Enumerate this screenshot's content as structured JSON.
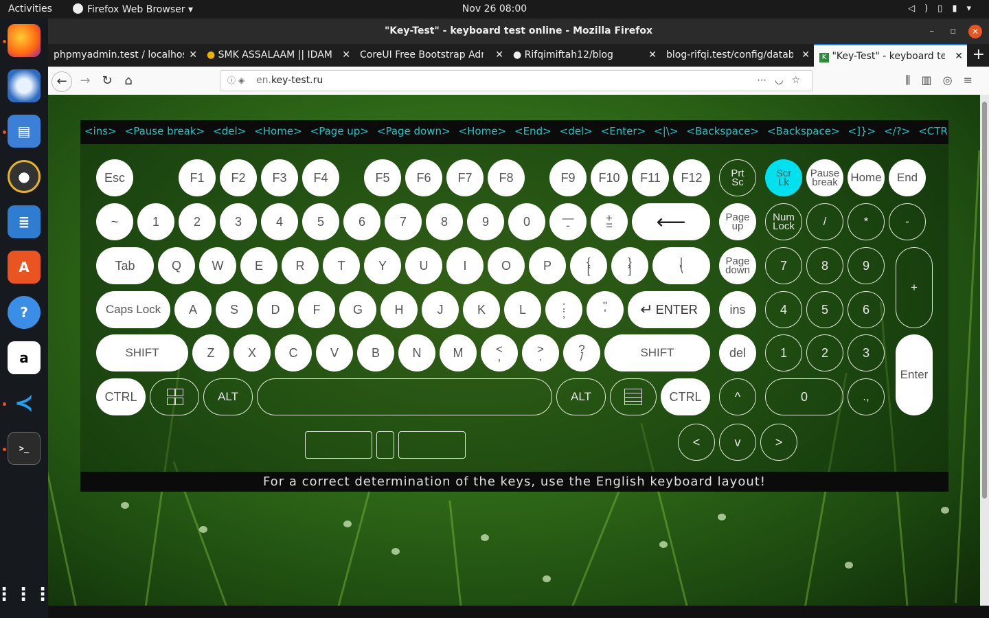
{
  "topbar": {
    "activities": "Activities",
    "app_name": "Firefox Web Browser",
    "clock": "Nov 26  08:00"
  },
  "window": {
    "title": "\"Key-Test\" - keyboard test online - Mozilla Firefox"
  },
  "tabs": [
    {
      "title": "phpmyadmin.test / localhost",
      "active": false
    },
    {
      "title": "SMK ASSALAAM || IDAM",
      "active": false
    },
    {
      "title": "CoreUI Free Bootstrap Admin",
      "active": false
    },
    {
      "title": "Rifqimiftah12/blog",
      "active": false
    },
    {
      "title": "blog-rifqi.test/config/database",
      "active": false
    },
    {
      "title": "\"Key-Test\" - keyboard test",
      "active": true
    }
  ],
  "nav": {
    "url_prefix": "en.",
    "url_domain": "key-test.ru"
  },
  "page": {
    "history": [
      "<ins>",
      "<Pause break>",
      "<del>",
      "<Home>",
      "<Page up>",
      "<Page down>",
      "<Home>",
      "<End>",
      "<del>",
      "<Enter>",
      "<|\\>",
      "<Backspace>",
      "<Backspace>",
      "<]}>",
      "</?>",
      "<CTRL>",
      "<'\">",
      "<[{>"
    ],
    "notice": "For a correct determination of the keys, use the English keyboard layout!"
  },
  "keys": {
    "esc": "Esc",
    "f1": "F1",
    "f2": "F2",
    "f3": "F3",
    "f4": "F4",
    "f5": "F5",
    "f6": "F6",
    "f7": "F7",
    "f8": "F8",
    "f9": "F9",
    "f10": "F10",
    "f11": "F11",
    "f12": "F12",
    "prtsc_1": "Prt",
    "prtsc_2": "Sc",
    "scrlk_1": "Scr",
    "scrlk_2": "Lk",
    "pause_1": "Pause",
    "pause_2": "break",
    "home": "Home",
    "end": "End",
    "tilde": "~",
    "d1": "1",
    "d2": "2",
    "d3": "3",
    "d4": "4",
    "d5": "5",
    "d6": "6",
    "d7": "7",
    "d8": "8",
    "d9": "9",
    "d0": "0",
    "minus_top": "—",
    "minus_bot": "-",
    "plus_top": "+",
    "plus_bot": "=",
    "backspace": "⟵",
    "pgup_1": "Page",
    "pgup_2": "up",
    "numlock_1": "Num",
    "numlock_2": "Lock",
    "np_div": "/",
    "np_mul": "*",
    "np_sub": "-",
    "tab": "Tab",
    "q": "Q",
    "w": "W",
    "e": "E",
    "r": "R",
    "t": "T",
    "y": "Y",
    "u": "U",
    "i": "I",
    "o": "O",
    "p": "P",
    "lbr_top": "{",
    "lbr_bot": "[",
    "rbr_top": "}",
    "rbr_bot": "]",
    "bsl_top": "|",
    "bsl_bot": "\\",
    "pgdn_1": "Page",
    "pgdn_2": "down",
    "np7": "7",
    "np8": "8",
    "np9": "9",
    "np_add": "+",
    "caps": "Caps Lock",
    "a": "A",
    "s": "S",
    "d": "D",
    "f": "F",
    "g": "G",
    "h": "H",
    "j": "J",
    "k": "K",
    "l": "L",
    "semi_top": ":",
    "semi_bot": ";",
    "quote_top": "\"",
    "quote_bot": "'",
    "enter": "ENTER",
    "enter_arrow": "↵",
    "ins": "ins",
    "np4": "4",
    "np5": "5",
    "np6": "6",
    "lshift": "SHIFT",
    "z": "Z",
    "x": "X",
    "c": "C",
    "v": "V",
    "b": "B",
    "n": "N",
    "m": "M",
    "comma_top": "<",
    "comma_bot": ",",
    "period_top": ">",
    "period_bot": ".",
    "slash_top": "?",
    "slash_bot": "/",
    "rshift": "SHIFT",
    "del": "del",
    "np1": "1",
    "np2": "2",
    "np3": "3",
    "np_enter": "Enter",
    "lctrl": "CTRL",
    "lalt": "ALT",
    "ralt": "ALT",
    "rctrl": "CTRL",
    "up": "^",
    "np0": "0",
    "np_dec": ".,",
    "left": "<",
    "down": "v",
    "right": ">"
  }
}
